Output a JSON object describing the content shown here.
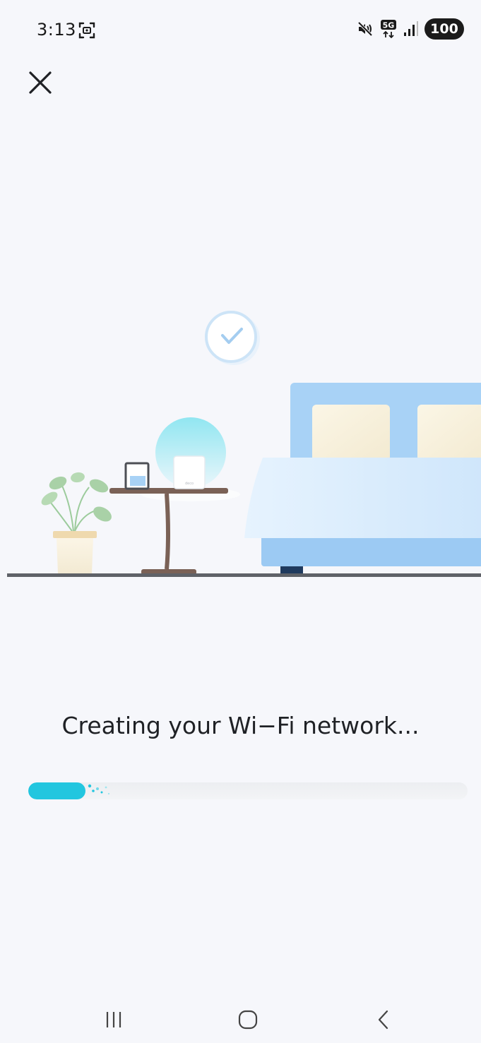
{
  "status_bar": {
    "time": "3:13",
    "battery_level": "100",
    "network_label": "5G",
    "icons": [
      "screenshot-icon",
      "mute-icon",
      "5g-icon",
      "signal-icon",
      "battery-icon"
    ]
  },
  "header": {
    "close_icon": "close-icon"
  },
  "main": {
    "message": "Creating your Wi−Fi network...",
    "progress": 0.13
  },
  "colors": {
    "background": "#f6f7fb",
    "accent": "#22c6df",
    "bed_blue": "#a9d3f6",
    "floor": "#5f6268"
  },
  "nav_bar": {
    "icons": [
      "recent-apps-icon",
      "home-icon",
      "back-icon"
    ]
  }
}
